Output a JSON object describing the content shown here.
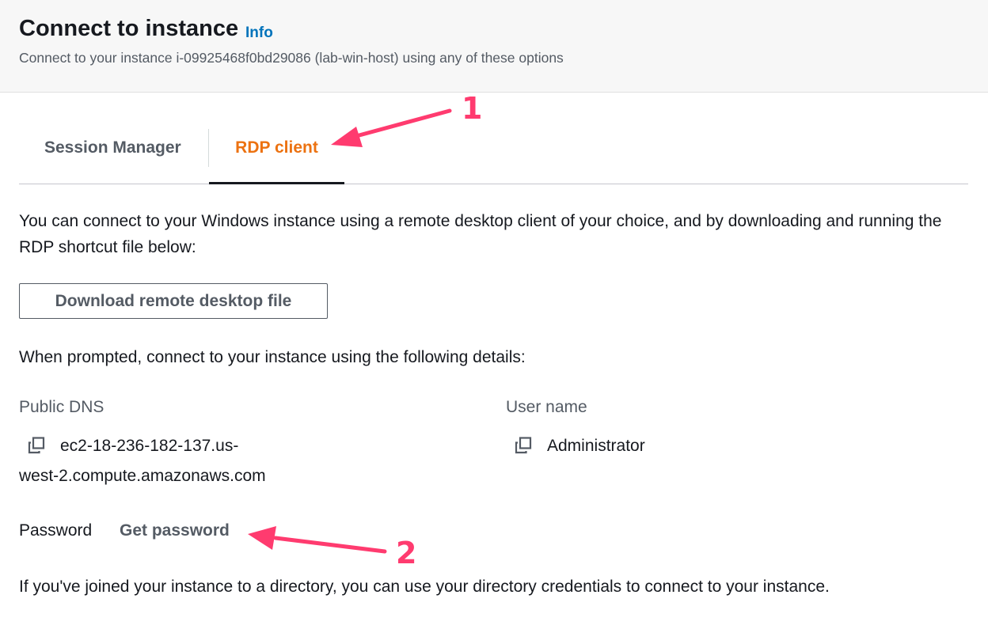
{
  "header": {
    "title": "Connect to instance",
    "info_link": "Info",
    "subtitle": "Connect to your instance i-09925468f0bd29086 (lab-win-host) using any of these options"
  },
  "tabs": [
    {
      "label": "Session Manager",
      "active": false
    },
    {
      "label": "RDP client",
      "active": true
    }
  ],
  "rdp": {
    "description": "You can connect to your Windows instance using a remote desktop client of your choice, and by downloading and running the RDP shortcut file below:",
    "download_button": "Download remote desktop file",
    "prompt": "When prompted, connect to your instance using the following details:",
    "public_dns_label": "Public DNS",
    "public_dns_line1": "ec2-18-236-182-137.us-",
    "public_dns_line2": "west-2.compute.amazonaws.com",
    "user_name_label": "User name",
    "user_name_value": "Administrator",
    "password_label": "Password",
    "get_password_link": "Get password",
    "footnote": "If you've joined your instance to a directory, you can use your directory credentials to connect to your instance."
  },
  "annotations": {
    "marker_1": "1",
    "marker_2": "2",
    "color": "#ff3b6f"
  },
  "colors": {
    "accent_orange": "#ec7211",
    "link_blue": "#0073bb",
    "text_dark": "#16191f",
    "text_gray": "#545b64"
  }
}
